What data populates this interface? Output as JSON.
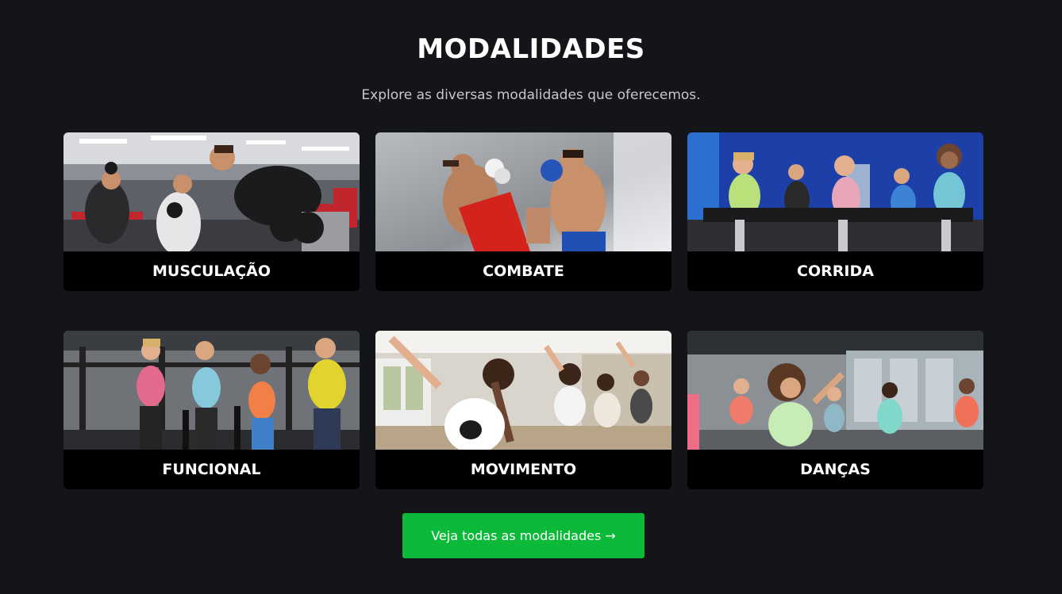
{
  "section": {
    "title": "MODALIDADES",
    "subtitle": "Explore as diversas modalidades que oferecemos."
  },
  "cards": [
    {
      "label": "MUSCULAÇÃO",
      "photo": "gym-weights-photo"
    },
    {
      "label": "COMBATE",
      "photo": "kickboxing-photo"
    },
    {
      "label": "CORRIDA",
      "photo": "spinning-class-photo"
    },
    {
      "label": "FUNCIONAL",
      "photo": "functional-training-photo"
    },
    {
      "label": "MOVIMENTO",
      "photo": "dance-movement-photo"
    },
    {
      "label": "DANÇAS",
      "photo": "dance-class-photo"
    }
  ],
  "cta": {
    "label": "Veja todas as modalidades →"
  },
  "colors": {
    "background": "#141519",
    "card_label_bg": "#000000",
    "accent": "#0cb939"
  }
}
